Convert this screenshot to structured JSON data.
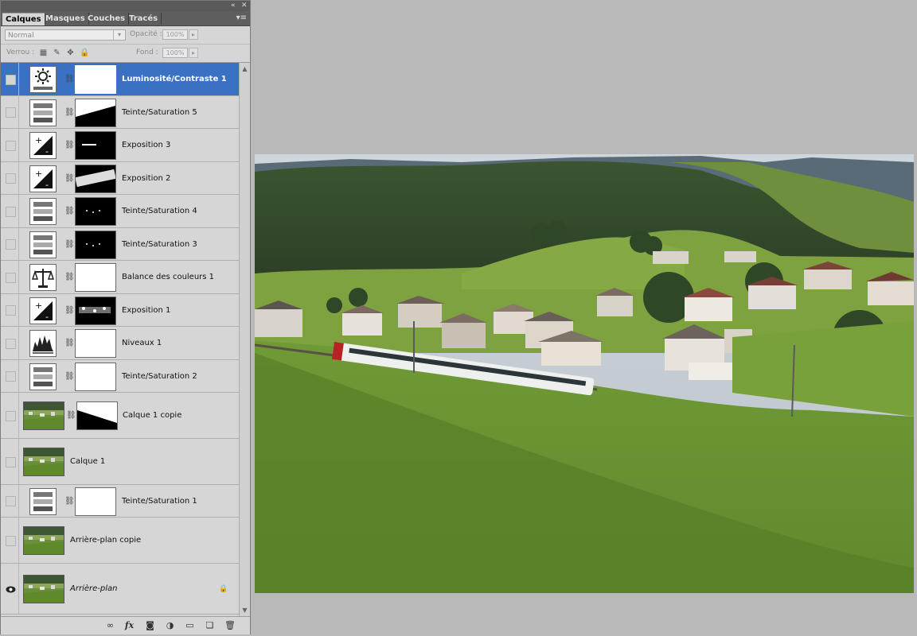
{
  "panel": {
    "tabs": [
      "Calques",
      "Masques",
      "Couches",
      "Tracés"
    ],
    "active_tab": "Calques",
    "blend_mode": "Normal",
    "opacity_label": "Opacité :",
    "opacity_value": "100%",
    "lock_label": "Verrou :",
    "fill_label": "Fond :",
    "fill_value": "100%"
  },
  "layers": [
    {
      "name": "Luminosité/Contraste 1",
      "kind": "adjustment",
      "icon": "brightness-contrast-icon",
      "mask": "white",
      "selected": true,
      "visible": false
    },
    {
      "name": "Teinte/Saturation 5",
      "kind": "adjustment",
      "icon": "hue-saturation-icon",
      "mask": "gradient-diagonal",
      "selected": false,
      "visible": false
    },
    {
      "name": "Exposition 3",
      "kind": "adjustment",
      "icon": "exposure-icon",
      "mask": "black-line",
      "selected": false,
      "visible": false
    },
    {
      "name": "Exposition 2",
      "kind": "adjustment",
      "icon": "exposure-icon",
      "mask": "black-band",
      "selected": false,
      "visible": false
    },
    {
      "name": "Teinte/Saturation 4",
      "kind": "adjustment",
      "icon": "hue-saturation-icon",
      "mask": "black-dots",
      "selected": false,
      "visible": false
    },
    {
      "name": "Teinte/Saturation 3",
      "kind": "adjustment",
      "icon": "hue-saturation-icon",
      "mask": "black-dots",
      "selected": false,
      "visible": false
    },
    {
      "name": "Balance des couleurs 1",
      "kind": "adjustment",
      "icon": "color-balance-icon",
      "mask": "white",
      "selected": false,
      "visible": false
    },
    {
      "name": "Exposition 1",
      "kind": "adjustment",
      "icon": "exposure-icon",
      "mask": "black-speckle",
      "selected": false,
      "visible": false
    },
    {
      "name": "Niveaux 1",
      "kind": "adjustment",
      "icon": "levels-icon",
      "mask": "white",
      "selected": false,
      "visible": false
    },
    {
      "name": "Teinte/Saturation 2",
      "kind": "adjustment",
      "icon": "hue-saturation-icon",
      "mask": "white",
      "selected": false,
      "visible": false
    },
    {
      "name": "Calque 1 copie",
      "kind": "pixel-masked",
      "icon": "photo-thumbnail",
      "mask": "hillside",
      "selected": false,
      "visible": false
    },
    {
      "name": "Calque 1",
      "kind": "pixel",
      "icon": "photo-thumbnail",
      "selected": false,
      "visible": false
    },
    {
      "name": "Teinte/Saturation 1",
      "kind": "adjustment",
      "icon": "hue-saturation-icon",
      "mask": "white",
      "selected": false,
      "visible": false
    },
    {
      "name": "Arrière-plan copie",
      "kind": "pixel",
      "icon": "photo-thumbnail",
      "selected": false,
      "visible": false
    },
    {
      "name": "Arrière-plan",
      "kind": "background",
      "icon": "photo-thumbnail",
      "selected": false,
      "visible": true,
      "locked": true,
      "italic": true
    }
  ],
  "bottom_icons": [
    "link-icon",
    "fx-icon",
    "add-mask-icon",
    "new-adjustment-icon",
    "new-group-icon",
    "new-layer-icon",
    "trash-icon"
  ],
  "canvas": {
    "subject": "photo-landscape"
  }
}
